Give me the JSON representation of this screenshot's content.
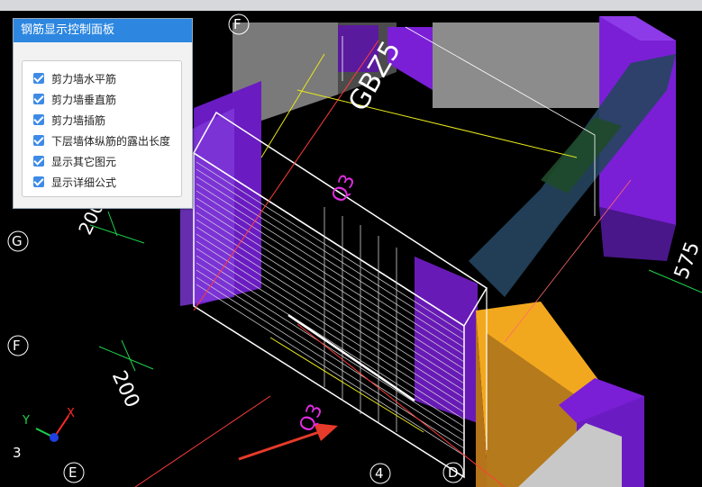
{
  "panel": {
    "title": "钢筋显示控制面板",
    "options": [
      {
        "label": "剪力墙水平筋",
        "checked": true
      },
      {
        "label": "剪力墙垂直筋",
        "checked": true
      },
      {
        "label": "剪力墙插筋",
        "checked": true
      },
      {
        "label": "下层墙体纵筋的露出长度",
        "checked": true
      },
      {
        "label": "显示其它图元",
        "checked": true
      },
      {
        "label": "显示详细公式",
        "checked": true
      }
    ]
  },
  "viewport": {
    "axis_labels": {
      "top_f": "F",
      "left_g": "G",
      "left_f": "F",
      "bottom_e": "E",
      "bottom_4": "4",
      "bottom_d": "D",
      "bottom_3": "3"
    },
    "texts": {
      "wall_name": "GBZ5",
      "q3_upper": "Q3",
      "q3_lower": "Q3",
      "dim_200_upper": "200",
      "dim_200_lower": "200",
      "dim_575": "575"
    },
    "axes": {
      "x": "X",
      "y": "Y"
    },
    "colors": {
      "purple": "#7a1fd6",
      "gold": "#f2a81e",
      "gray": "#8a8a8a",
      "white_line": "#ffffff",
      "red_line": "#ff3b3b",
      "yellow_line": "#e8e81a",
      "green_dim": "#1fd24a",
      "magenta_text": "#e02de0",
      "arrow": "#e63a2a"
    }
  }
}
